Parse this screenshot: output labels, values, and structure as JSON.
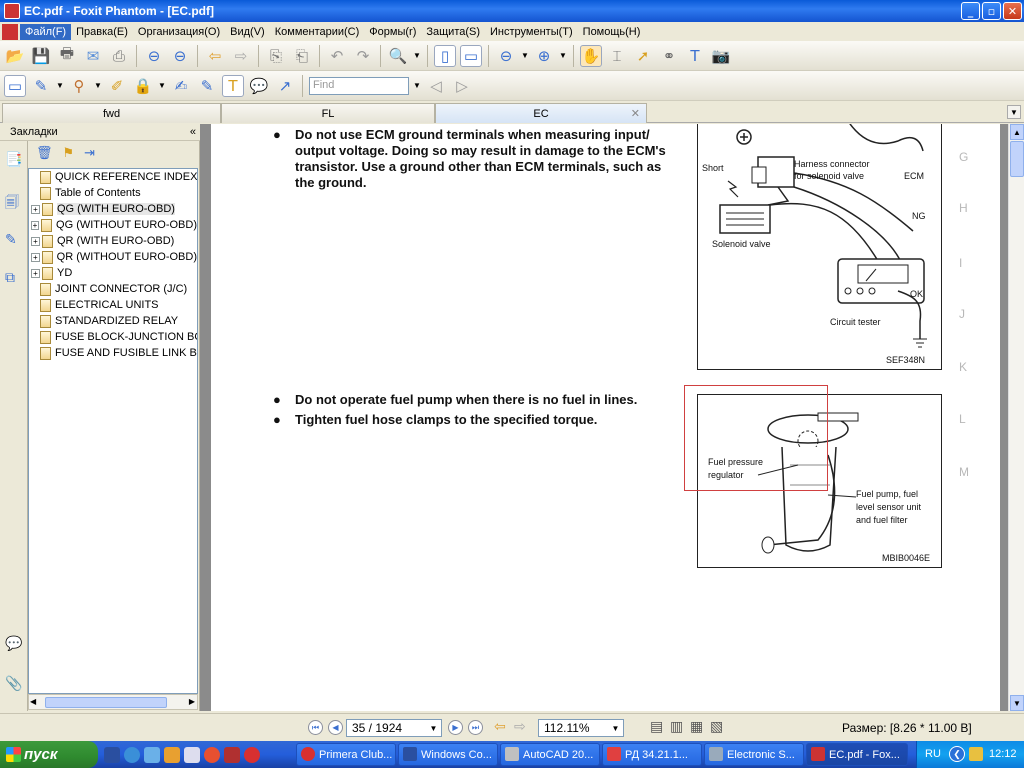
{
  "window": {
    "title": "EC.pdf - Foxit Phantom - [EC.pdf]",
    "buttons": {
      "minimize": "_",
      "maximize": "▫",
      "close": "✕"
    }
  },
  "menu": [
    "Файл(F)",
    "Правка(E)",
    "Организация(O)",
    "Вид(V)",
    "Комментарии(C)",
    "Формы(r)",
    "Защита(S)",
    "Инструменты(T)",
    "Помощь(H)"
  ],
  "toolbar": {
    "find_placeholder": "Find"
  },
  "tabs": [
    {
      "label": "fwd"
    },
    {
      "label": "FL"
    },
    {
      "label": "EC",
      "active": true
    }
  ],
  "bookmarks": {
    "header": "Закладки",
    "collapse": "«",
    "items": [
      {
        "label": "QUICK REFERENCE INDEX",
        "expandable": false,
        "indent": 0
      },
      {
        "label": "Table of Contents",
        "expandable": false,
        "indent": 0
      },
      {
        "label": "QG (WITH EURO-OBD)",
        "expandable": true,
        "indent": 1,
        "selected": true
      },
      {
        "label": "QG (WITHOUT EURO-OBD)",
        "expandable": true,
        "indent": 1
      },
      {
        "label": "QR (WITH EURO-OBD)",
        "expandable": true,
        "indent": 1
      },
      {
        "label": "QR (WITHOUT EURO-OBD)",
        "expandable": true,
        "indent": 1
      },
      {
        "label": "YD",
        "expandable": true,
        "indent": 1
      },
      {
        "label": "JOINT CONNECTOR (J/C)",
        "expandable": false,
        "indent": 0
      },
      {
        "label": "ELECTRICAL UNITS",
        "expandable": false,
        "indent": 0
      },
      {
        "label": "STANDARDIZED RELAY",
        "expandable": false,
        "indent": 0
      },
      {
        "label": "FUSE BLOCK-JUNCTION BOX (J",
        "expandable": false,
        "indent": 0
      },
      {
        "label": "FUSE AND FUSIBLE LINK BOX",
        "expandable": false,
        "indent": 0
      }
    ]
  },
  "document": {
    "bullet1_lines": [
      "Do not use ECM ground terminals when measuring input/",
      "output voltage. Doing so may result in damage to the ECM's",
      "transistor. Use a ground other than ECM terminals, such as",
      "the ground."
    ],
    "bullet2": "Do not operate fuel pump when there is no fuel in lines.",
    "bullet3": "Tighten fuel hose clamps to the specified torque.",
    "bullet_glyph": "●",
    "side_letters": [
      "G",
      "H",
      "I",
      "J",
      "K",
      "L",
      "M"
    ],
    "figure1": {
      "short": "Short",
      "harness": "Harness connector",
      "harness2": "for solenoid valve",
      "ecm": "ECM",
      "ng": "NG",
      "ok": "OK",
      "solenoid": "Solenoid valve",
      "tester": "Circuit tester",
      "code": "SEF348N"
    },
    "figure2": {
      "regulator1": "Fuel pressure",
      "regulator2": "regulator",
      "pump1": "Fuel pump, fuel",
      "pump2": "level sensor unit",
      "pump3": "and fuel filter",
      "code": "MBIB0046E"
    }
  },
  "status": {
    "page": "35 / 1924",
    "zoom": "112.11%",
    "size": "Размер: [8.26 * 11.00 B]"
  },
  "taskbar": {
    "start": "пуск",
    "tasks": [
      {
        "label": "Primera Club..."
      },
      {
        "label": "Windows Co..."
      },
      {
        "label": "AutoCAD 20..."
      },
      {
        "label": "РД 34.21.1..."
      },
      {
        "label": "Electronic S..."
      },
      {
        "label": "EC.pdf - Fox...",
        "active": true
      }
    ],
    "lang": "RU",
    "clock": "12:12"
  },
  "colors": {
    "accent": "#316ac5",
    "highlight_box": "#d04040",
    "taskbar": "#245edb"
  }
}
